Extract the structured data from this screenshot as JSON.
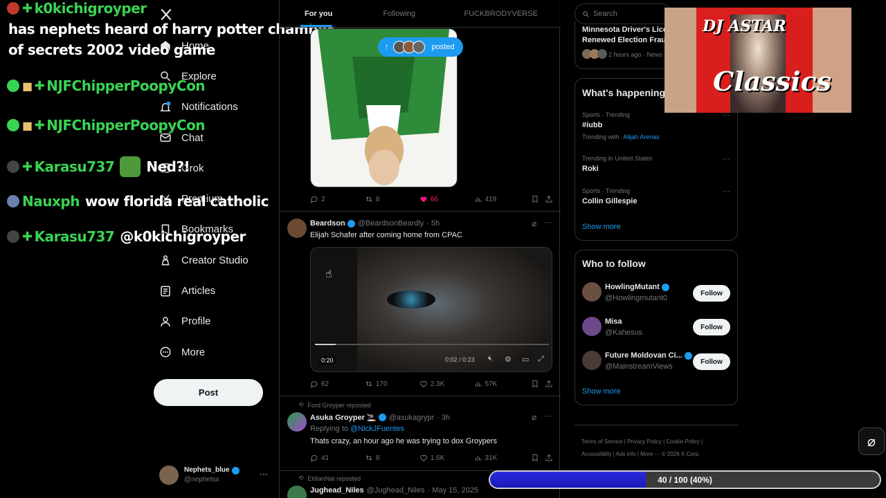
{
  "chat": [
    {
      "user": "k0kichigroyper",
      "msg": ""
    },
    {
      "user": "",
      "msg": "has nephets heard of harry potter chamber"
    },
    {
      "user": "",
      "msg": "of secrets 2002 video game"
    },
    {
      "user": "NJFChipperPoopyCon",
      "msg": ""
    },
    {
      "user": "NJFChipperPoopyCon",
      "msg": ""
    },
    {
      "user": "Karasu737",
      "msg": "Ned?!"
    },
    {
      "user": "Nauxph",
      "msg": "wow florida real catholic"
    },
    {
      "user": "Karasu737",
      "msg": "@k0kichigroyper"
    }
  ],
  "nav": {
    "items": [
      {
        "label": "Home",
        "icon": "home-icon"
      },
      {
        "label": "Explore",
        "icon": "search-icon"
      },
      {
        "label": "Notifications",
        "icon": "bell-icon"
      },
      {
        "label": "Chat",
        "icon": "mail-icon"
      },
      {
        "label": "Grok",
        "icon": "grok-icon"
      },
      {
        "label": "Premium",
        "icon": "x-icon"
      },
      {
        "label": "Bookmarks",
        "icon": "bookmark-icon"
      },
      {
        "label": "Creator Studio",
        "icon": "creator-icon"
      },
      {
        "label": "Articles",
        "icon": "article-icon"
      },
      {
        "label": "Profile",
        "icon": "profile-icon"
      },
      {
        "label": "More",
        "icon": "more-icon"
      }
    ],
    "post_label": "Post",
    "me": {
      "name": "Nephets_blue",
      "handle": "@nephetsx"
    }
  },
  "tabs": [
    "For you",
    "Following",
    "FUCKBRODYVERSE"
  ],
  "posted_pill": "posted",
  "tweets": [
    {
      "stats": {
        "replies": "2",
        "reposts": "8",
        "likes": "66",
        "views": "419"
      }
    },
    {
      "name": "Beardson",
      "handle": "@BeardsonBeardly",
      "time": "· 5h",
      "text": "Elijah Schafer after coming home from CPAC",
      "video": {
        "duration": "0:20",
        "elapsed": "0:02 / 0:23",
        "progress": 0.09
      },
      "stats": {
        "replies": "62",
        "reposts": "170",
        "likes": "2.3K",
        "views": "57K"
      }
    },
    {
      "repost_by": "Ford Groyper reposted",
      "name": "Asuka Groyper",
      "handle": "@asukagrypr",
      "time": "· 3h",
      "reply_prefix": "Replying to",
      "reply_to": "@NickJFuentes",
      "text": "Thats crazy, an hour ago he was trying to dox Groypers",
      "stats": {
        "replies": "41",
        "reposts": "8",
        "likes": "1.6K",
        "views": "31K"
      }
    },
    {
      "repost_by": "EldianNat reposted",
      "name": "Jughead_Niles",
      "handle": "@Jughead_Niles",
      "time": "· May 15, 2025"
    }
  ],
  "right": {
    "search_placeholder": "Search",
    "news": {
      "title_1": "Minnesota Driver's Licen",
      "title_2": "Renewed Election Fraud",
      "meta": "2 hours ago · News ·"
    },
    "happening": {
      "title": "What's happening",
      "trends": [
        {
          "meta": "Sports · Trending",
          "name": "#iubb",
          "extra_prefix": "Trending with",
          "extra": "Alijah Arenas"
        },
        {
          "meta": "Trending in United States",
          "name": "Roki"
        },
        {
          "meta": "Sports · Trending",
          "name": "Collin Gillespie"
        }
      ],
      "show_more": "Show more"
    },
    "follow": {
      "title": "Who to follow",
      "users": [
        {
          "name": "HowlingMutant",
          "handle": "@Howlingmutant0",
          "btn": "Follow"
        },
        {
          "name": "Misa",
          "handle": "@Kahesus",
          "btn": "Follow"
        },
        {
          "name": "Future Moldovan Ci...",
          "handle": "@MainstreamViews",
          "btn": "Follow"
        }
      ],
      "show_more": "Show more"
    },
    "footer_1": "Terms of Service  |  Privacy Policy  |  Cookie Policy  |",
    "footer_2": "Accessibility  |  Ads info  |  More ···  © 2026 X Corp."
  },
  "dj": {
    "top": "DJ ASTAR",
    "main": "Classics"
  },
  "progress": {
    "label": "40 / 100 (40%)",
    "value": 0.4
  },
  "colors": {
    "accent": "#1d9bf0",
    "chat_green": "#39d353",
    "like_pink": "#f91880",
    "progress_blue": "#1a1ab8"
  }
}
